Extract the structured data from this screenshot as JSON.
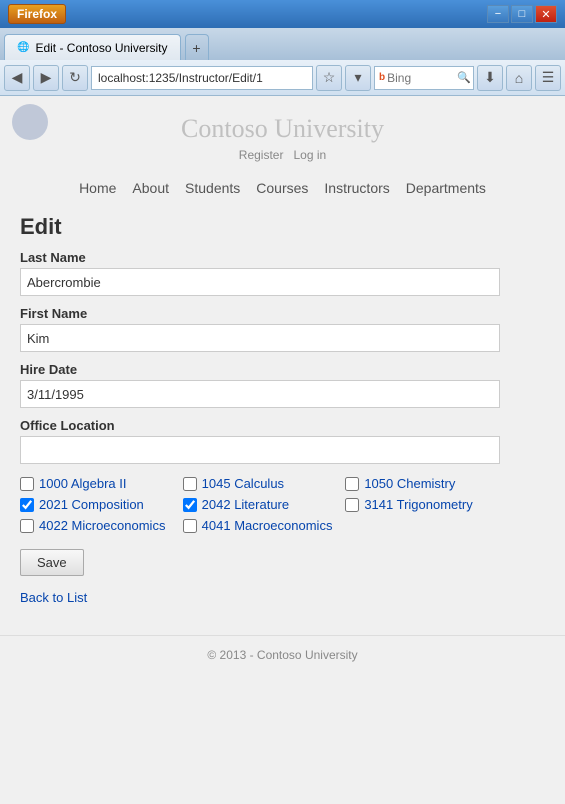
{
  "browser": {
    "firefox_label": "Firefox",
    "tab_title": "Edit - Contoso University",
    "tab_new_label": "+",
    "address": "localhost:1235/Instructor/Edit/1",
    "search_placeholder": "Bing",
    "win_minimize": "−",
    "win_restore": "□",
    "win_close": "✕"
  },
  "site": {
    "title": "Contoso University",
    "auth_register": "Register",
    "auth_login": "Log in",
    "nav": [
      "Home",
      "About",
      "Students",
      "Courses",
      "Instructors",
      "Departments"
    ]
  },
  "page": {
    "heading": "Edit",
    "last_name_label": "Last Name",
    "last_name_value": "Abercrombie",
    "first_name_label": "First Name",
    "first_name_value": "Kim",
    "hire_date_label": "Hire Date",
    "hire_date_value": "3/11/1995",
    "office_label": "Office Location",
    "office_value": "",
    "save_label": "Save",
    "back_label": "Back to List"
  },
  "courses": [
    {
      "id": "1000",
      "name": "Algebra II",
      "checked": false
    },
    {
      "id": "1045",
      "name": "Calculus",
      "checked": false
    },
    {
      "id": "1050",
      "name": "Chemistry",
      "checked": false
    },
    {
      "id": "2021",
      "name": "Composition",
      "checked": true
    },
    {
      "id": "2042",
      "name": "Literature",
      "checked": true
    },
    {
      "id": "3141",
      "name": "Trigonometry",
      "checked": false
    },
    {
      "id": "4022",
      "name": "Microeconomics",
      "checked": false
    },
    {
      "id": "4041",
      "name": "Macroeconomics",
      "checked": false
    }
  ],
  "footer": {
    "copyright": "© 2013 - Contoso University"
  }
}
